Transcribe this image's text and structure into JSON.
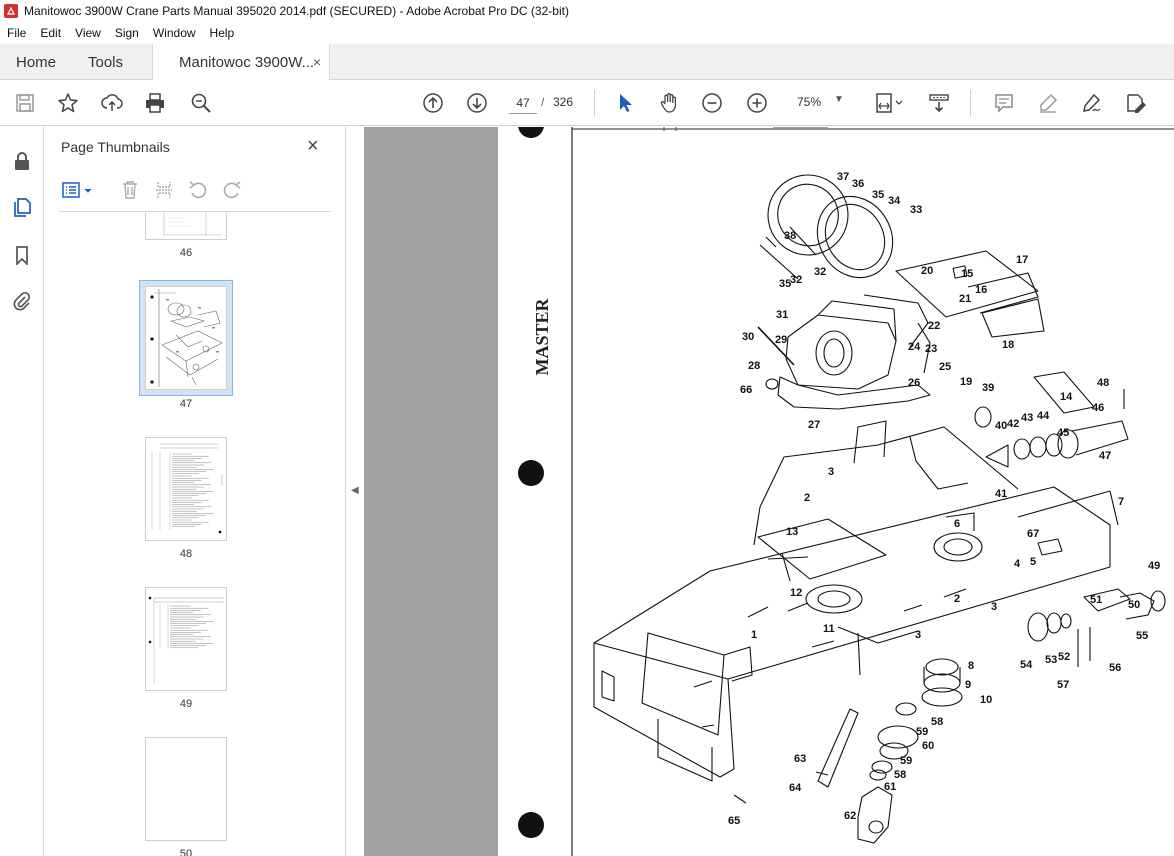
{
  "window": {
    "title": "Manitowoc 3900W Crane Parts Manual 395020 2014.pdf (SECURED) - Adobe Acrobat Pro DC (32-bit)"
  },
  "menu": [
    "File",
    "Edit",
    "View",
    "Sign",
    "Window",
    "Help"
  ],
  "tabs": {
    "home": "Home",
    "tools": "Tools",
    "document": "Manitowoc 3900W...",
    "close_glyph": "×"
  },
  "toolbar": {
    "current_page": "47",
    "page_separator": "/",
    "total_pages": "326",
    "zoom": "75%",
    "icons": [
      "save-icon",
      "bookmark-star-icon",
      "upload-share-icon",
      "print-icon",
      "find-zoom-icon",
      "page-up-icon",
      "page-down-icon",
      "select-cursor-icon",
      "hand-icon",
      "zoom-out-icon",
      "zoom-in-icon",
      "page-fit-icon",
      "scroll-mode-icon",
      "comment-icon",
      "highlight-icon",
      "fill-sign-icon",
      "edit-pdf-icon"
    ]
  },
  "rail": {
    "icons": [
      "lock-icon",
      "pages-icon",
      "bookmark-icon",
      "attachment-icon"
    ]
  },
  "thumbnails": {
    "title": "Page Thumbnails",
    "close_glyph": "×",
    "pages": [
      {
        "label": "46"
      },
      {
        "label": "47",
        "selected": true
      },
      {
        "label": "48"
      },
      {
        "label": "49"
      },
      {
        "label": "50"
      }
    ]
  },
  "document": {
    "rotated_stamp": "MASTER",
    "callouts": [
      "1",
      "2",
      "3",
      "4",
      "5",
      "6",
      "7",
      "8",
      "9",
      "10",
      "11",
      "12",
      "13",
      "14",
      "15",
      "16",
      "17",
      "18",
      "19",
      "20",
      "21",
      "22",
      "23",
      "24",
      "25",
      "26",
      "27",
      "28",
      "29",
      "30",
      "31",
      "32",
      "33",
      "34",
      "35",
      "36",
      "37",
      "38",
      "39",
      "40",
      "41",
      "42",
      "43",
      "44",
      "45",
      "46",
      "47",
      "48",
      "49",
      "50",
      "51",
      "52",
      "53",
      "54",
      "55",
      "56",
      "57",
      "58",
      "59",
      "60",
      "61",
      "62",
      "63",
      "64",
      "65",
      "66",
      "67"
    ]
  }
}
